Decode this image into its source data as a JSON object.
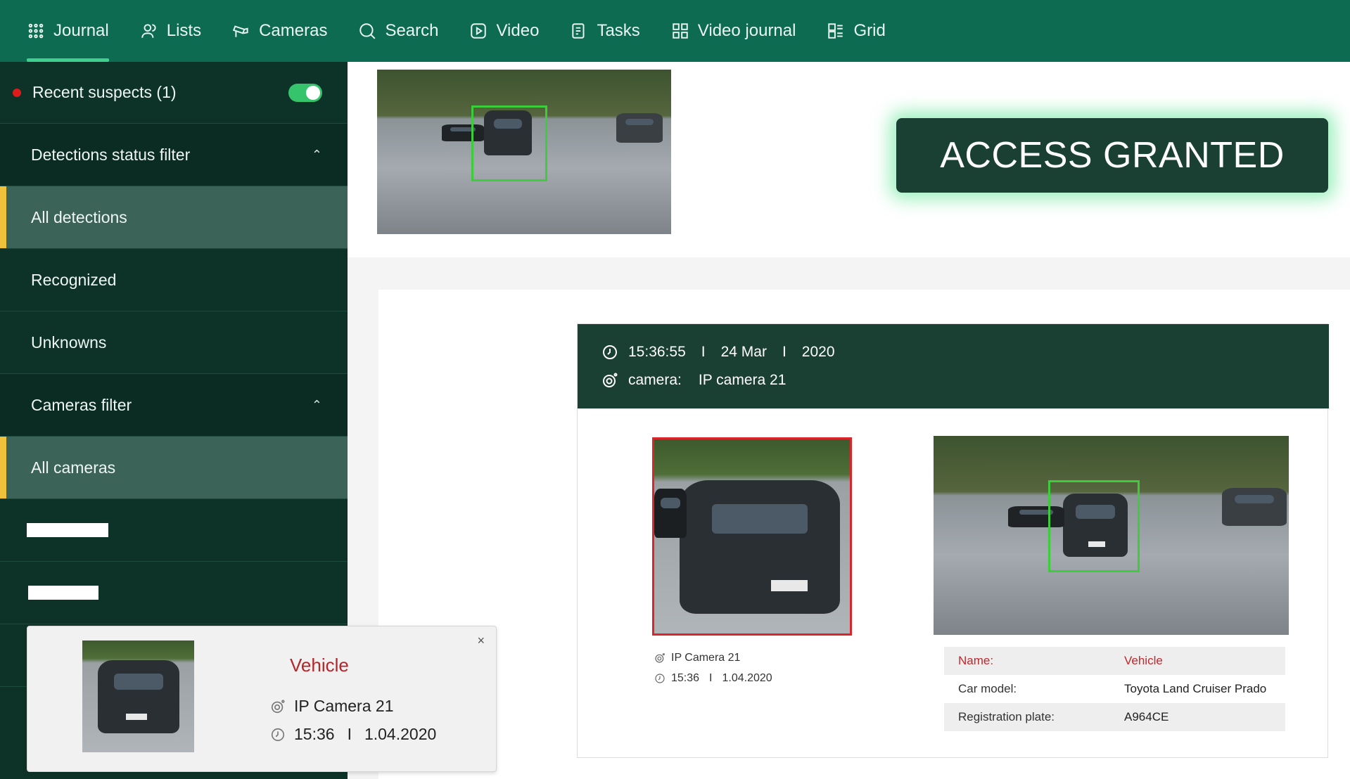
{
  "nav": {
    "items": [
      {
        "label": "Journal",
        "icon": "grid-dots-icon",
        "active": true
      },
      {
        "label": "Lists",
        "icon": "users-icon"
      },
      {
        "label": "Cameras",
        "icon": "camera-icon"
      },
      {
        "label": "Search",
        "icon": "search-icon"
      },
      {
        "label": "Video",
        "icon": "play-icon"
      },
      {
        "label": "Tasks",
        "icon": "tasks-icon"
      },
      {
        "label": "Video journal",
        "icon": "video-journal-icon"
      },
      {
        "label": "Grid",
        "icon": "grid-icon"
      }
    ]
  },
  "sidebar": {
    "recent_suspects": "Recent suspects (1)",
    "recent_toggle_on": true,
    "detections_filter_title": "Detections status filter",
    "detections": [
      "All detections",
      "Recognized",
      "Unknowns"
    ],
    "cameras_filter_title": "Cameras filter",
    "cameras": [
      "All cameras"
    ]
  },
  "banner": {
    "access_text": "ACCESS GRANTED"
  },
  "event": {
    "time": "15:36:55",
    "day": "24 Mar",
    "year": "2020",
    "separator": "I",
    "camera_label": "camera:",
    "camera_name": "IP camera 21",
    "crop_camera": "IP Camera 21",
    "crop_time": "15:36",
    "crop_date": "1.04.2020",
    "details": [
      {
        "key": "Name:",
        "value": "Vehicle",
        "highlight": true
      },
      {
        "key": "Car model:",
        "value": "Toyota Land Cruiser Prado"
      },
      {
        "key": "Registration plate:",
        "value": "A964CE"
      }
    ]
  },
  "popup": {
    "title": "Vehicle",
    "camera": "IP Camera 21",
    "time": "15:36",
    "date": "1.04.2020",
    "separator": "I",
    "close": "×"
  },
  "colors": {
    "nav_bg": "#0d6b52",
    "sidebar_bg": "#0d3328",
    "accent_yellow": "#f0c23b",
    "access_bg": "#1a4034",
    "bbox_green": "#3ccc3c",
    "alert_red": "#c0282c"
  }
}
